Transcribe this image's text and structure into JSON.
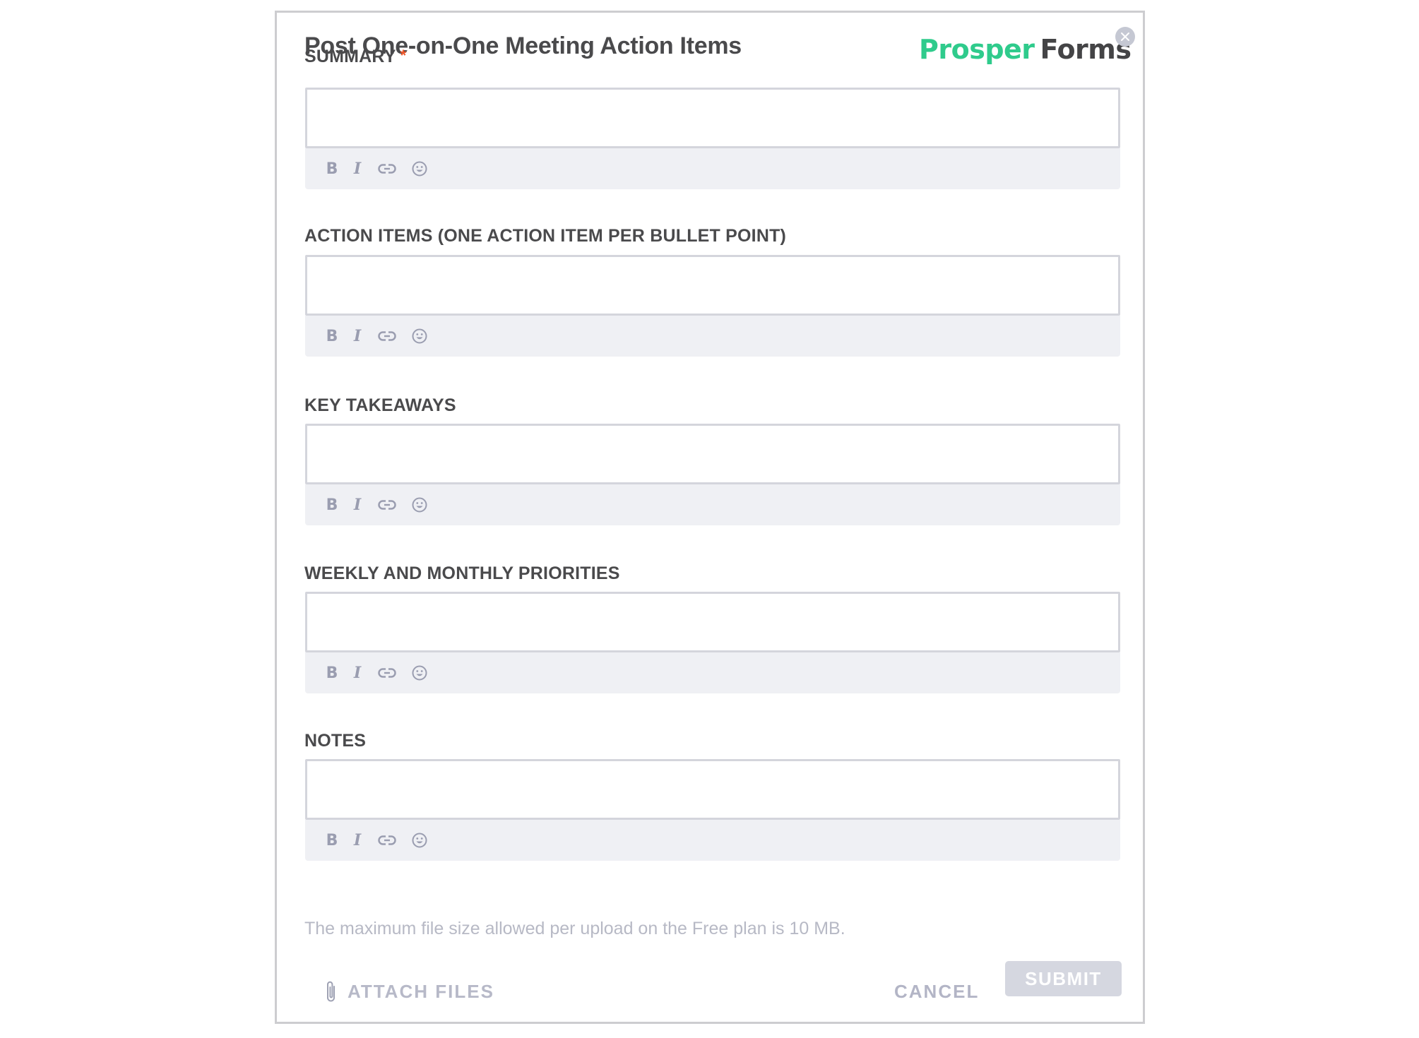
{
  "form": {
    "title": "Post One-on-One Meeting Action Items",
    "logo": {
      "part1": "Prosper",
      "part2": "Forms",
      "accent_color": "#2fcb8c",
      "dark_color": "#444446"
    },
    "close_icon": "close-icon"
  },
  "fields": [
    {
      "label": "SUMMARY",
      "required": true,
      "required_marker": "*",
      "value": ""
    },
    {
      "label": "ACTION ITEMS (ONE ACTION ITEM PER BULLET POINT)",
      "required": false,
      "value": ""
    },
    {
      "label": "KEY TAKEAWAYS",
      "required": false,
      "value": ""
    },
    {
      "label": "WEEKLY AND MONTHLY PRIORITIES",
      "required": false,
      "value": ""
    },
    {
      "label": "NOTES",
      "required": false,
      "value": ""
    }
  ],
  "toolbar": {
    "bold": "B",
    "italic": "I",
    "link_icon": "link-icon",
    "emoji_icon": "emoji-icon"
  },
  "footer": {
    "file_note": "The maximum file size allowed per upload on the Free plan is 10 MB.",
    "attach_label": "ATTACH FILES",
    "cancel_label": "CANCEL",
    "submit_label": "SUBMIT"
  }
}
